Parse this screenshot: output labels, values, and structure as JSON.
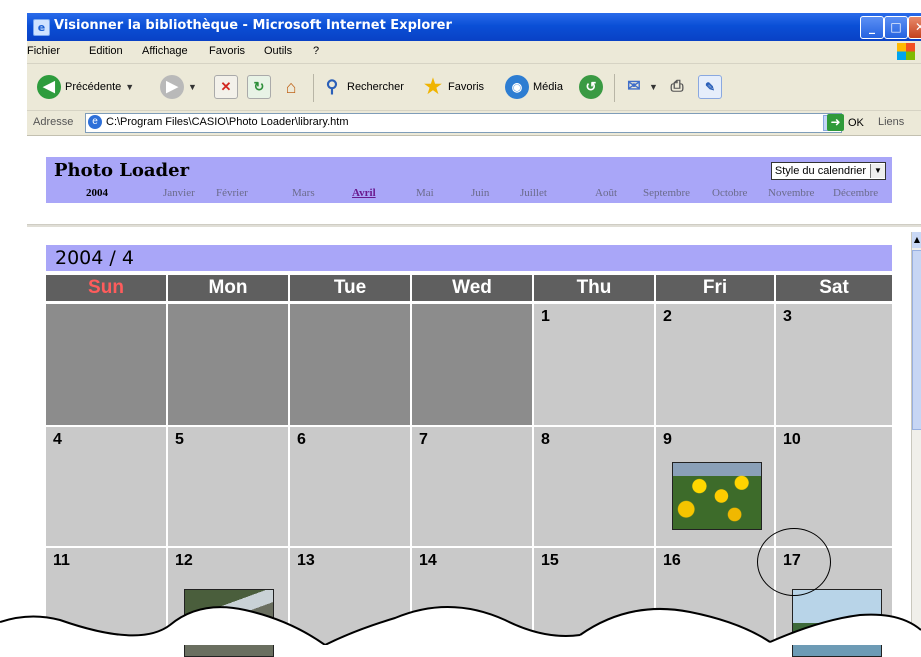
{
  "window": {
    "title": "Visionner la bibliothèque - Microsoft Internet Explorer",
    "controls": [
      "minimize",
      "maximize",
      "close"
    ]
  },
  "menu": [
    "Fichier",
    "Edition",
    "Affichage",
    "Favoris",
    "Outils",
    "?"
  ],
  "toolbar": {
    "back_label": "Précédente",
    "search_label": "Rechercher",
    "favorites_label": "Favoris",
    "media_label": "Média"
  },
  "address": {
    "label": "Adresse",
    "url": "C:\\Program Files\\CASIO\\Photo Loader\\library.htm",
    "go_label": "OK",
    "links_label": "Liens"
  },
  "app": {
    "title": "Photo Loader",
    "view_select": "Style du calendrier",
    "year": "2004",
    "months": [
      "Janvier",
      "Février",
      "Mars",
      "Avril",
      "Mai",
      "Juin",
      "Juillet",
      "Août",
      "Septembre",
      "Octobre",
      "Novembre",
      "Décembre"
    ],
    "active_month": "Avril"
  },
  "calendar": {
    "heading": "2004 / 4",
    "weekdays": [
      "Sun",
      "Mon",
      "Tue",
      "Wed",
      "Thu",
      "Fri",
      "Sat"
    ],
    "days": [
      "1",
      "2",
      "3",
      "4",
      "5",
      "6",
      "7",
      "8",
      "9",
      "10",
      "11",
      "12",
      "13",
      "14",
      "15",
      "16",
      "17"
    ],
    "days_with_photos": [
      "9",
      "12",
      "17"
    ],
    "highlighted_day": "17"
  },
  "colors": {
    "accent": "#a9a6f8",
    "weekday_header": "#5f5f5f",
    "sunday_text": "#ff5c5c",
    "cell": "#c9c9c9",
    "empty_cell": "#8c8c8c",
    "active_month_text": "#6a1a8e"
  }
}
